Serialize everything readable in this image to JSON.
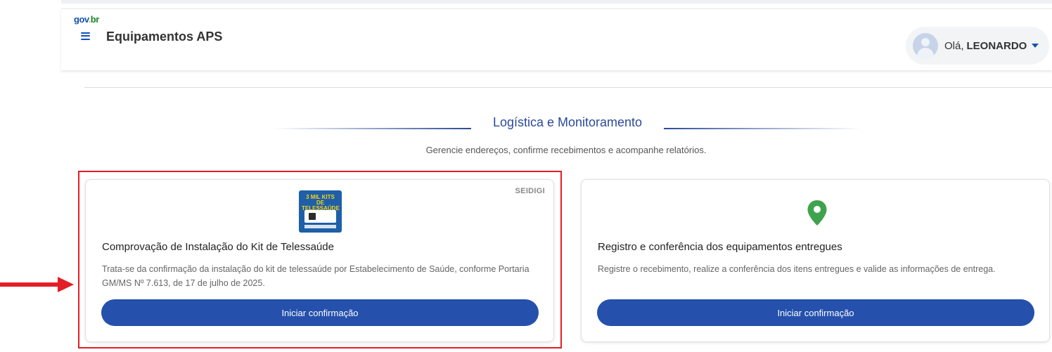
{
  "header": {
    "logo_gov": "gov",
    "logo_dot": ".",
    "logo_br": "br",
    "app_title": "Equipamentos APS",
    "user_greeting": "Olá,",
    "user_name": "LEONARDO"
  },
  "section": {
    "title": "Logística e Monitoramento",
    "subtitle": "Gerencie endereços, confirme recebimentos e acompanhe relatórios."
  },
  "cards": [
    {
      "badge": "SEIDIGI",
      "image_text": "3 MIL KITS DE TELESSAÚDE",
      "title": "Comprovação de Instalação do Kit de Telessaúde",
      "text": "Trata-se da confirmação da instalação do kit de telessaúde por Estabelecimento de Saúde, conforme Portaria GM/MS Nº 7.613, de 17 de julho de 2025.",
      "button": "Iniciar confirmação"
    },
    {
      "icon": "map-pin-icon",
      "title": "Registro e conferência dos equipamentos entregues",
      "text": "Registre o recebimento, realize a conferência dos itens entregues e valide as informações de entrega.",
      "button": "Iniciar confirmação"
    }
  ],
  "colors": {
    "primary": "#2550ac",
    "title_blue": "#2a4a9a",
    "highlight_red": "#e31e24",
    "pin_green": "#3fa34d"
  }
}
